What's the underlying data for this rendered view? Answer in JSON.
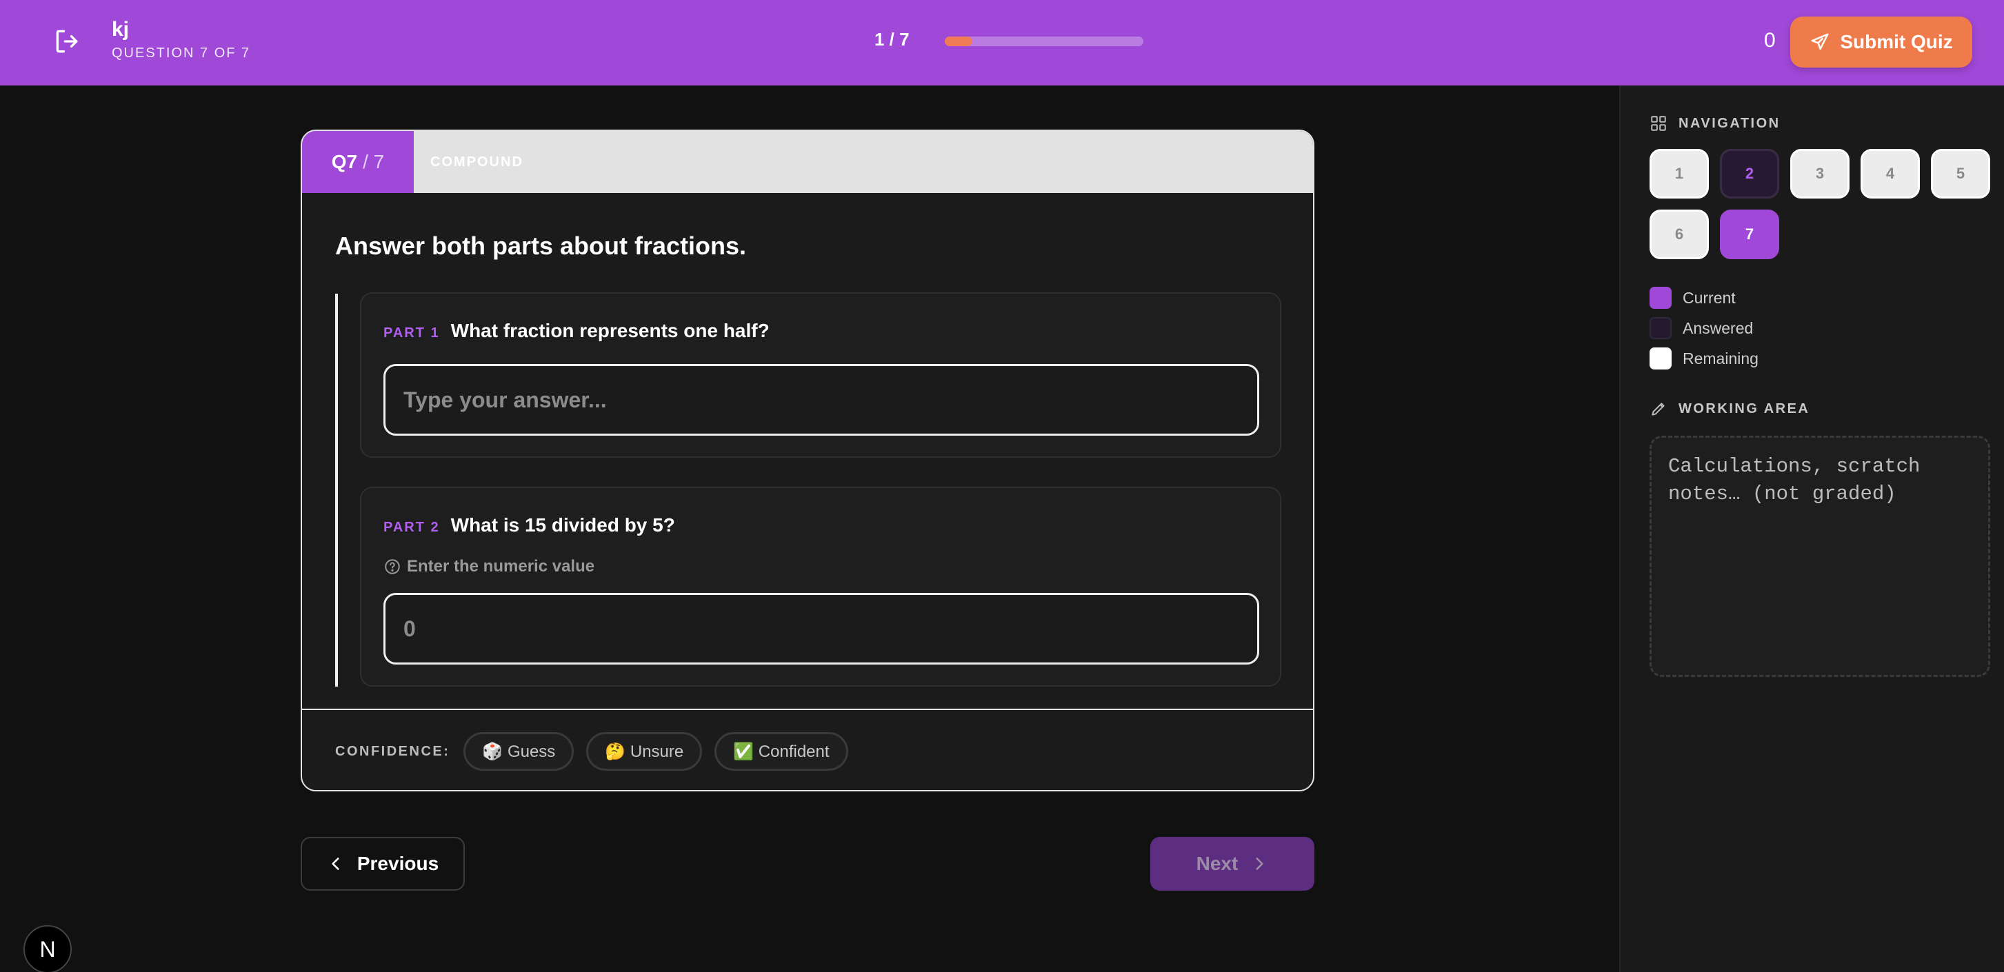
{
  "header": {
    "quiz_title": "kj",
    "question_status": "QUESTION 7 OF 7",
    "progress_label": "1 / 7",
    "progress_fraction": 0.14,
    "score": "0",
    "submit_label": "Submit Quiz",
    "background_color": "#a048d8",
    "accent_color": "#f07b4a"
  },
  "question": {
    "number_label": "Q7",
    "total_label": "/ 7",
    "type_label": "COMPOUND",
    "prompt": "Answer both parts about fractions.",
    "parts": [
      {
        "tag": "PART 1",
        "text": "What fraction represents one half?",
        "placeholder": "Type your answer...",
        "value": ""
      },
      {
        "tag": "PART 2",
        "text": "What is 15 divided by 5?",
        "hint": "Enter the numeric value",
        "placeholder": "0",
        "value": ""
      }
    ]
  },
  "confidence": {
    "label": "CONFIDENCE:",
    "options": [
      "🎲 Guess",
      "🤔 Unsure",
      "✅ Confident"
    ]
  },
  "navigation_buttons": {
    "previous_label": "Previous",
    "next_label": "Next"
  },
  "sidebar": {
    "navigation_title": "NAVIGATION",
    "questions": [
      {
        "label": "1",
        "state": "remaining"
      },
      {
        "label": "2",
        "state": "answered"
      },
      {
        "label": "3",
        "state": "remaining"
      },
      {
        "label": "4",
        "state": "remaining"
      },
      {
        "label": "5",
        "state": "remaining"
      },
      {
        "label": "6",
        "state": "remaining"
      },
      {
        "label": "7",
        "state": "current"
      }
    ],
    "legend": {
      "current": "Current",
      "answered": "Answered",
      "remaining": "Remaining"
    },
    "working_area_title": "WORKING AREA",
    "working_area_placeholder": "Calculations, scratch notes… (not graded)"
  },
  "footer": {
    "badge_letter": "N"
  }
}
